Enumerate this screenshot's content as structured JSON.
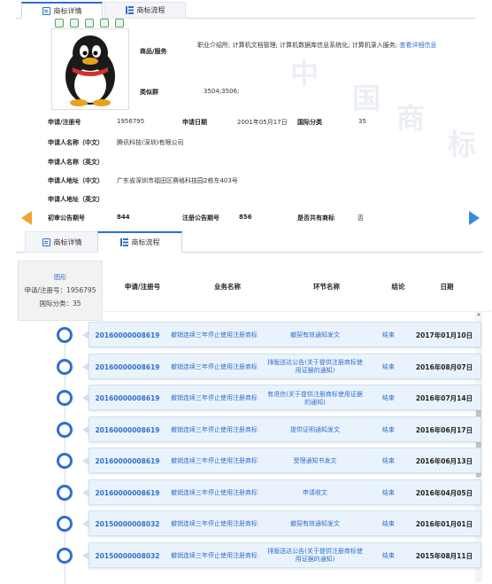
{
  "detail_panel": {
    "tabs": [
      {
        "label": "商标详情",
        "active": true
      },
      {
        "label": "商标流程",
        "active": false
      }
    ],
    "toolbar_icons": [
      "download-icon",
      "expand-icon",
      "image-icon",
      "share-icon",
      "settings-icon"
    ],
    "goods_services": {
      "label": "商品/服务",
      "value": "职业介绍所; 计算机文档管理; 计算机数据库信息系统化; 计算机录入服务;",
      "more_link": "查看详细信息"
    },
    "similar_group": {
      "label": "类似群",
      "value": "3504;3506;"
    },
    "fields": {
      "reg_no": {
        "label": "申请/注册号",
        "value": "1956795"
      },
      "apply_date": {
        "label": "申请日期",
        "value": "2001年05月17日"
      },
      "intl_class": {
        "label": "国际分类",
        "value": "35"
      },
      "applicant_cn": {
        "label": "申请人名称（中文）",
        "value": "腾讯科技(深圳)有限公司"
      },
      "applicant_en": {
        "label": "申请人名称（英文）",
        "value": ""
      },
      "address_cn": {
        "label": "申请人地址（中文）",
        "value": "广东省深圳市福田区赛格科技园2栋东403号"
      },
      "address_en": {
        "label": "申请人地址（英文）",
        "value": ""
      },
      "prelim_pub_no": {
        "label": "初审公告期号",
        "value": "844"
      },
      "reg_pub_no": {
        "label": "注册公告期号",
        "value": "856"
      },
      "shared": {
        "label": "是否共有商标",
        "value": "否"
      }
    },
    "watermark": [
      "中",
      "国",
      "商",
      "标"
    ]
  },
  "flow_panel": {
    "tabs": [
      {
        "label": "商标详情",
        "active": false
      },
      {
        "label": "商标流程",
        "active": true
      }
    ],
    "side_card": {
      "image_link": "图形",
      "reg_no_text": "申请/注册号：1956795",
      "class_text": "国际分类：35"
    },
    "columns": [
      "申请/注册号",
      "业务名称",
      "环节名称",
      "结论",
      "日期"
    ],
    "rows": [
      {
        "no": "20160000008619",
        "business": "撤销连续三年停止使用注册商标",
        "step": "撤契有效通知发文",
        "result": "结束",
        "date": "2017年01月10日"
      },
      {
        "no": "20160000008619",
        "business": "撤销连续三年停止使用注册商标",
        "step": "排版送达公告(关于提供注册商标使用证据的通知)",
        "result": "结束",
        "date": "2016年08月07日"
      },
      {
        "no": "20160000008619",
        "business": "撤销连续三年停止使用注册商标",
        "step": "有退信(关于提供注册商标使用证据的通知)",
        "result": "结束",
        "date": "2016年07月14日"
      },
      {
        "no": "20160000008619",
        "business": "撤销连续三年停止使用注册商标",
        "step": "提供证明通知发文",
        "result": "结束",
        "date": "2016年06月17日"
      },
      {
        "no": "20160000008619",
        "business": "撤销连续三年停止使用注册商标",
        "step": "受理通知书发文",
        "result": "结束",
        "date": "2016年06月13日"
      },
      {
        "no": "20160000008619",
        "business": "撤销连续三年停止使用注册商标",
        "step": "申请收文",
        "result": "结束",
        "date": "2016年04月05日"
      },
      {
        "no": "20150000008032",
        "business": "撤销连续三年停止使用注册商标",
        "step": "撤契有效通知发文",
        "result": "结束",
        "date": "2016年01月01日"
      },
      {
        "no": "20150000008032",
        "business": "撤销连续三年停止使用注册商标",
        "step": "排版送达公告(关于提供注册商标使用证据的通知)",
        "result": "结束",
        "date": "2015年08月11日"
      }
    ]
  },
  "colors": {
    "accent": "#2f6fd0",
    "row_bg": "#eaf3fb",
    "nav_left": "#f0a33a",
    "nav_right": "#3a8ad8"
  }
}
